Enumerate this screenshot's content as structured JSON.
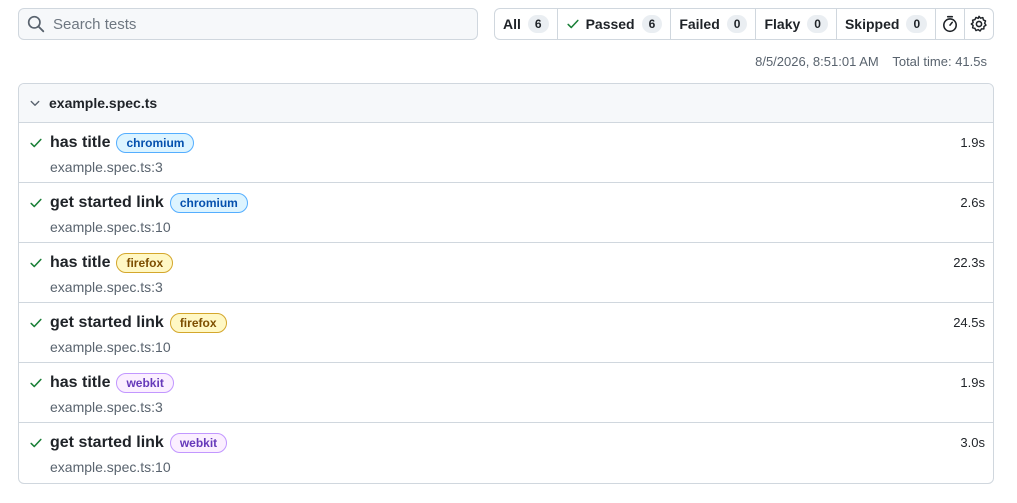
{
  "search": {
    "placeholder": "Search tests"
  },
  "filters": [
    {
      "label": "All",
      "count": "6"
    },
    {
      "label": "Passed",
      "count": "6"
    },
    {
      "label": "Failed",
      "count": "0"
    },
    {
      "label": "Flaky",
      "count": "0"
    },
    {
      "label": "Skipped",
      "count": "0"
    }
  ],
  "meta": {
    "timestamp": "8/5/2026, 8:51:01 AM",
    "total_time": "Total time: 41.5s"
  },
  "suite": {
    "file": "example.spec.ts",
    "tests": [
      {
        "title": "has title",
        "project": "chromium",
        "location": "example.spec.ts:3",
        "duration": "1.9s"
      },
      {
        "title": "get started link",
        "project": "chromium",
        "location": "example.spec.ts:10",
        "duration": "2.6s"
      },
      {
        "title": "has title",
        "project": "firefox",
        "location": "example.spec.ts:3",
        "duration": "22.3s"
      },
      {
        "title": "get started link",
        "project": "firefox",
        "location": "example.spec.ts:10",
        "duration": "24.5s"
      },
      {
        "title": "has title",
        "project": "webkit",
        "location": "example.spec.ts:3",
        "duration": "1.9s"
      },
      {
        "title": "get started link",
        "project": "webkit",
        "location": "example.spec.ts:10",
        "duration": "3.0s"
      }
    ]
  },
  "colors": {
    "pass": "#1a7f37",
    "border": "#d0d7de",
    "header_bg": "#f6f8fa"
  }
}
